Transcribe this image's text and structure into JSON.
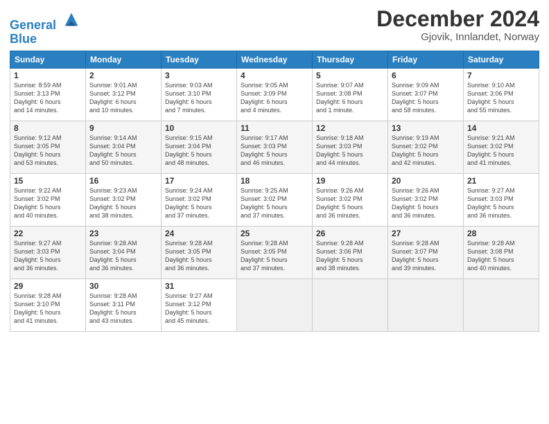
{
  "header": {
    "logo_line1": "General",
    "logo_line2": "Blue",
    "title": "December 2024",
    "subtitle": "Gjovik, Innlandet, Norway"
  },
  "columns": [
    "Sunday",
    "Monday",
    "Tuesday",
    "Wednesday",
    "Thursday",
    "Friday",
    "Saturday"
  ],
  "weeks": [
    [
      {
        "day": "1",
        "info": "Sunrise: 8:59 AM\nSunset: 3:13 PM\nDaylight: 6 hours\nand 14 minutes."
      },
      {
        "day": "2",
        "info": "Sunrise: 9:01 AM\nSunset: 3:12 PM\nDaylight: 6 hours\nand 10 minutes."
      },
      {
        "day": "3",
        "info": "Sunrise: 9:03 AM\nSunset: 3:10 PM\nDaylight: 6 hours\nand 7 minutes."
      },
      {
        "day": "4",
        "info": "Sunrise: 9:05 AM\nSunset: 3:09 PM\nDaylight: 6 hours\nand 4 minutes."
      },
      {
        "day": "5",
        "info": "Sunrise: 9:07 AM\nSunset: 3:08 PM\nDaylight: 6 hours\nand 1 minute."
      },
      {
        "day": "6",
        "info": "Sunrise: 9:09 AM\nSunset: 3:07 PM\nDaylight: 5 hours\nand 58 minutes."
      },
      {
        "day": "7",
        "info": "Sunrise: 9:10 AM\nSunset: 3:06 PM\nDaylight: 5 hours\nand 55 minutes."
      }
    ],
    [
      {
        "day": "8",
        "info": "Sunrise: 9:12 AM\nSunset: 3:05 PM\nDaylight: 5 hours\nand 53 minutes."
      },
      {
        "day": "9",
        "info": "Sunrise: 9:14 AM\nSunset: 3:04 PM\nDaylight: 5 hours\nand 50 minutes."
      },
      {
        "day": "10",
        "info": "Sunrise: 9:15 AM\nSunset: 3:04 PM\nDaylight: 5 hours\nand 48 minutes."
      },
      {
        "day": "11",
        "info": "Sunrise: 9:17 AM\nSunset: 3:03 PM\nDaylight: 5 hours\nand 46 minutes."
      },
      {
        "day": "12",
        "info": "Sunrise: 9:18 AM\nSunset: 3:03 PM\nDaylight: 5 hours\nand 44 minutes."
      },
      {
        "day": "13",
        "info": "Sunrise: 9:19 AM\nSunset: 3:02 PM\nDaylight: 5 hours\nand 42 minutes."
      },
      {
        "day": "14",
        "info": "Sunrise: 9:21 AM\nSunset: 3:02 PM\nDaylight: 5 hours\nand 41 minutes."
      }
    ],
    [
      {
        "day": "15",
        "info": "Sunrise: 9:22 AM\nSunset: 3:02 PM\nDaylight: 5 hours\nand 40 minutes."
      },
      {
        "day": "16",
        "info": "Sunrise: 9:23 AM\nSunset: 3:02 PM\nDaylight: 5 hours\nand 38 minutes."
      },
      {
        "day": "17",
        "info": "Sunrise: 9:24 AM\nSunset: 3:02 PM\nDaylight: 5 hours\nand 37 minutes."
      },
      {
        "day": "18",
        "info": "Sunrise: 9:25 AM\nSunset: 3:02 PM\nDaylight: 5 hours\nand 37 minutes."
      },
      {
        "day": "19",
        "info": "Sunrise: 9:26 AM\nSunset: 3:02 PM\nDaylight: 5 hours\nand 36 minutes."
      },
      {
        "day": "20",
        "info": "Sunrise: 9:26 AM\nSunset: 3:02 PM\nDaylight: 5 hours\nand 36 minutes."
      },
      {
        "day": "21",
        "info": "Sunrise: 9:27 AM\nSunset: 3:03 PM\nDaylight: 5 hours\nand 36 minutes."
      }
    ],
    [
      {
        "day": "22",
        "info": "Sunrise: 9:27 AM\nSunset: 3:03 PM\nDaylight: 5 hours\nand 36 minutes."
      },
      {
        "day": "23",
        "info": "Sunrise: 9:28 AM\nSunset: 3:04 PM\nDaylight: 5 hours\nand 36 minutes."
      },
      {
        "day": "24",
        "info": "Sunrise: 9:28 AM\nSunset: 3:05 PM\nDaylight: 5 hours\nand 36 minutes."
      },
      {
        "day": "25",
        "info": "Sunrise: 9:28 AM\nSunset: 3:05 PM\nDaylight: 5 hours\nand 37 minutes."
      },
      {
        "day": "26",
        "info": "Sunrise: 9:28 AM\nSunset: 3:06 PM\nDaylight: 5 hours\nand 38 minutes."
      },
      {
        "day": "27",
        "info": "Sunrise: 9:28 AM\nSunset: 3:07 PM\nDaylight: 5 hours\nand 39 minutes."
      },
      {
        "day": "28",
        "info": "Sunrise: 9:28 AM\nSunset: 3:08 PM\nDaylight: 5 hours\nand 40 minutes."
      }
    ],
    [
      {
        "day": "29",
        "info": "Sunrise: 9:28 AM\nSunset: 3:10 PM\nDaylight: 5 hours\nand 41 minutes."
      },
      {
        "day": "30",
        "info": "Sunrise: 9:28 AM\nSunset: 3:11 PM\nDaylight: 5 hours\nand 43 minutes."
      },
      {
        "day": "31",
        "info": "Sunrise: 9:27 AM\nSunset: 3:12 PM\nDaylight: 5 hours\nand 45 minutes."
      },
      null,
      null,
      null,
      null
    ]
  ]
}
